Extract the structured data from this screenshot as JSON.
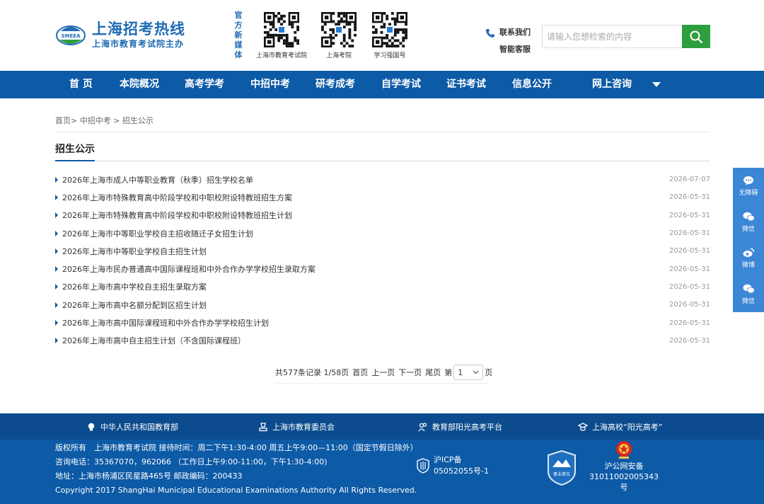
{
  "header": {
    "logo_title": "上海招考热线",
    "logo_sub": "上海市教育考试院主办",
    "logo_badge": "SMEEA",
    "media_label": "官方新媒体",
    "qr_codes": [
      {
        "caption": "上海市教育考试院"
      },
      {
        "caption": "上海考院"
      },
      {
        "caption": "学习强国号"
      }
    ],
    "contact_label": "联系我们",
    "assistant_label": "智能客服",
    "search_placeholder": "请输入您想检索的内容"
  },
  "nav": {
    "items": [
      "首 页",
      "本院概况",
      "高考学考",
      "中招中考",
      "研考成考",
      "自学考试",
      "证书考试",
      "信息公开",
      "网上咨询"
    ]
  },
  "breadcrumb": "首页> 中招中考 > 招生公示",
  "section_title": "招生公示",
  "list": [
    {
      "title": "2026年上海市成人中等职业教育（秋季）招生学校名单",
      "date": "2026-07-07"
    },
    {
      "title": "2026年上海市特殊教育高中阶段学校和中职校附设特教班招生方案",
      "date": "2026-05-31"
    },
    {
      "title": "2026年上海市特殊教育高中阶段学校和中职校附设特教班招生计划",
      "date": "2026-05-31"
    },
    {
      "title": "2026年上海市中等职业学校自主招收随迁子女招生计划",
      "date": "2026-05-31"
    },
    {
      "title": "2026年上海市中等职业学校自主招生计划",
      "date": "2026-05-31"
    },
    {
      "title": "2026年上海市民办普通高中国际课程班和中外合作办学学校招生录取方案",
      "date": "2026-05-31"
    },
    {
      "title": "2026年上海市高中学校自主招生录取方案",
      "date": "2026-05-31"
    },
    {
      "title": "2026年上海市高中名额分配到区招生计划",
      "date": "2026-05-31"
    },
    {
      "title": "2026年上海市高中国际课程班和中外合作办学学校招生计划",
      "date": "2026-05-31"
    },
    {
      "title": "2026年上海市高中自主招生计划（不含国际课程班）",
      "date": "2026-05-31"
    }
  ],
  "pager": {
    "summary": "共577条记录 1/58页",
    "first": "首页",
    "prev": "上一页",
    "next": "下一页",
    "last": "尾页",
    "jump_prefix": "第",
    "current": "1",
    "jump_suffix": "页"
  },
  "float": [
    "无障碍",
    "微信",
    "微博",
    "微信"
  ],
  "footer": {
    "links": [
      "中华人民共和国教育部",
      "上海市教育委员会",
      "教育部阳光高考平台",
      "上海高校“阳光高考”"
    ],
    "info": [
      "版权所有　上海市教育考试院 接待时间：周二下午1:30-4:00 周五上午9:00—11:00（国定节假日除外）",
      "咨询电话：35367070，962066 （工作日上午9:00-11:00，下午1:30-4:00)",
      "地址：上海市杨浦区民星路465号 邮政编码：200433",
      "Copyright 2017 ShangHai Municipal Educational Examinations Authority All Rights Reserved."
    ],
    "icp_line1": "沪ICP备",
    "icp_line2": "05052055号-1",
    "badge_text": "事业单位",
    "police_line1": "沪公网安备",
    "police_line2": "31011002005343",
    "police_line3": "号"
  },
  "colors": {
    "nav_blue": "#0d5aa6",
    "footer_dark": "#0c4c8e",
    "search_green": "#2e9e3e",
    "logo_blue": "#1f6bb5"
  }
}
